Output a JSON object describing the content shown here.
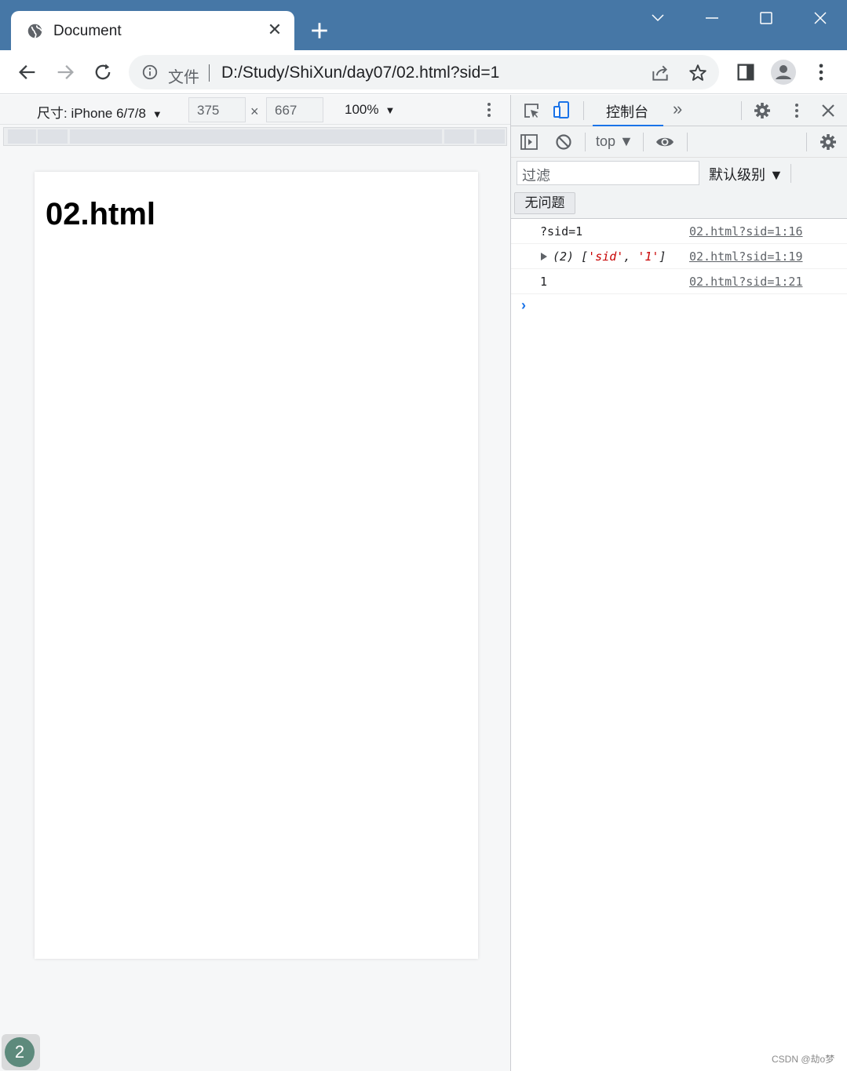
{
  "browser": {
    "tab_title": "Document",
    "tab_close_glyph": "✕",
    "url_prefix": "文件",
    "url": "D:/Study/ShiXun/day07/02.html?sid=1"
  },
  "icons": {
    "favicon": "globe-icon",
    "new_tab": "plus-icon",
    "window": [
      "chevron-down-icon",
      "minimize-icon",
      "maximize-icon",
      "close-icon"
    ],
    "nav": [
      "back-arrow-icon",
      "forward-arrow-icon",
      "reload-icon"
    ],
    "omnibox": [
      "info-icon",
      "share-icon",
      "star-icon"
    ],
    "toolbar_right": [
      "side-panel-icon",
      "profile-icon",
      "kebab-menu-icon"
    ]
  },
  "device_toolbar": {
    "dimensions_label": "尺寸: iPhone 6/7/8",
    "caret": "▼",
    "width": "375",
    "height": "667",
    "times": "×",
    "zoom": "100%"
  },
  "page": {
    "heading": "02.html"
  },
  "badge": {
    "count": "2"
  },
  "devtools": {
    "active_tab": "控制台",
    "more_tabs": "»",
    "context": "top ▼",
    "filter_placeholder": "过滤",
    "level": "默认级别 ▼",
    "no_issues": "无问题",
    "console": [
      {
        "message": "?sid=1",
        "source": "02.html?sid=1:16"
      },
      {
        "count": "(2) ",
        "open": "[",
        "item1": "'sid'",
        "comma": ", ",
        "item2": "'1'",
        "close": "]",
        "source": "02.html?sid=1:19"
      },
      {
        "message": "1",
        "source": "02.html?sid=1:21"
      }
    ],
    "prompt": "›"
  },
  "watermark": "CSDN @劫o梦",
  "colors": {
    "titlebar": "#4677a6",
    "accent": "#1a73e8",
    "string_red": "#c80000",
    "badge_green": "#5d8a7c"
  }
}
